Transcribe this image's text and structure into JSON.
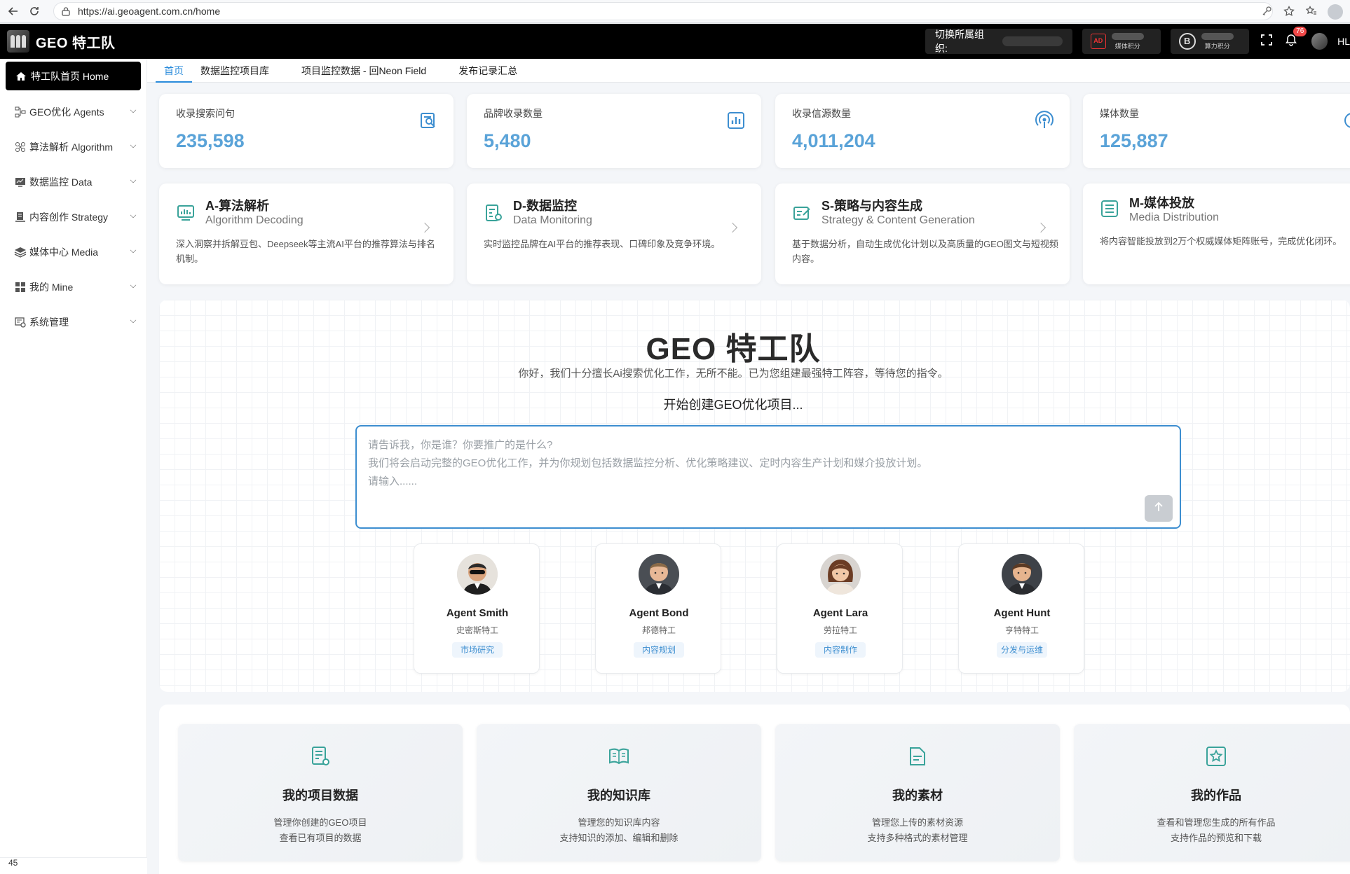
{
  "browser": {
    "url": "https://ai.geoagent.com.cn/home"
  },
  "header": {
    "title": "GEO 特工队",
    "org_switch_label": "切换所属组织:",
    "media_points_label": "媒体积分",
    "compute_points_label": "算力积分",
    "notification_count": "76",
    "user_name": "HL"
  },
  "sidebar": {
    "home_label": "特工队首页 Home",
    "items": [
      {
        "label": "GEO优化 Agents",
        "icon": "agents-icon"
      },
      {
        "label": "算法解析 Algorithm",
        "icon": "algorithm-icon"
      },
      {
        "label": "数据监控 Data",
        "icon": "monitor-icon"
      },
      {
        "label": "内容创作 Strategy",
        "icon": "content-icon"
      },
      {
        "label": "媒体中心 Media",
        "icon": "layers-icon"
      },
      {
        "label": "我的 Mine",
        "icon": "grid-icon"
      },
      {
        "label": "系统管理",
        "icon": "settings-icon"
      }
    ],
    "bottom_text": "45"
  },
  "tabs": [
    {
      "label": "首页",
      "active": true
    },
    {
      "label": "数据监控项目库",
      "active": false
    },
    {
      "label": "项目监控数据 - 回Neon Field",
      "active": false
    },
    {
      "label": "发布记录汇总",
      "active": false
    }
  ],
  "stats": [
    {
      "label": "收录搜索问句",
      "value": "235,598",
      "icon": "search-doc-icon"
    },
    {
      "label": "品牌收录数量",
      "value": "5,480",
      "icon": "bar-chart-icon"
    },
    {
      "label": "收录信源数量",
      "value": "4,011,204",
      "icon": "signal-icon"
    },
    {
      "label": "媒体数量",
      "value": "125,887",
      "icon": "media-icon"
    }
  ],
  "modules": [
    {
      "title": "A-算法解析",
      "subtitle": "Algorithm Decoding",
      "desc": "深入洞察并拆解豆包、Deepseek等主流AI平台的推荐算法与排名机制。",
      "icon": "algorithm-chart-icon"
    },
    {
      "title": "D-数据监控",
      "subtitle": "Data Monitoring",
      "desc": "实时监控品牌在AI平台的推荐表现、口碑印象及竞争环境。",
      "icon": "data-monitor-icon"
    },
    {
      "title": "S-策略与内容生成",
      "subtitle": "Strategy & Content Generation",
      "desc": "基于数据分析，自动生成优化计划以及高质量的GEO图文与短视频内容。",
      "icon": "strategy-edit-icon"
    },
    {
      "title": "M-媒体投放",
      "subtitle": "Media Distribution",
      "desc": "将内容智能投放到2万个权威媒体矩阵账号，完成优化闭环。",
      "icon": "list-icon"
    }
  ],
  "hero": {
    "title": "GEO 特工队",
    "subtitle": "你好，我们十分擅长Ai搜索优化工作，无所不能。已为您组建最强特工阵容，等待您的指令。",
    "start_text": "开始创建GEO优化项目...",
    "placeholder": "请告诉我，你是谁？你要推广的是什么?\n我们将会启动完整的GEO优化工作，并为你规划包括数据监控分析、优化策略建议、定时内容生产计划和媒介投放计划。\n请输入......"
  },
  "agents": [
    {
      "name": "Agent Smith",
      "cn": "史密斯特工",
      "tag": "市场研究",
      "avatar": "agent-smith-avatar"
    },
    {
      "name": "Agent Bond",
      "cn": "邦德特工",
      "tag": "内容规划",
      "avatar": "agent-bond-avatar"
    },
    {
      "name": "Agent Lara",
      "cn": "劳拉特工",
      "tag": "内容制作",
      "avatar": "agent-lara-avatar"
    },
    {
      "name": "Agent Hunt",
      "cn": "亨特特工",
      "tag": "分发与运维",
      "avatar": "agent-hunt-avatar"
    }
  ],
  "bottom_cards": [
    {
      "title": "我的项目数据",
      "desc1": "管理你创建的GEO项目",
      "desc2": "查看已有项目的数据",
      "icon": "project-doc-icon"
    },
    {
      "title": "我的知识库",
      "desc1": "管理您的知识库内容",
      "desc2": "支持知识的添加、编辑和删除",
      "icon": "book-icon"
    },
    {
      "title": "我的素材",
      "desc1": "管理您上传的素材资源",
      "desc2": "支持多种格式的素材管理",
      "icon": "folder-icon"
    },
    {
      "title": "我的作品",
      "desc1": "查看和管理您生成的所有作品",
      "desc2": "支持作品的预览和下载",
      "icon": "star-icon"
    }
  ],
  "colors": {
    "accent": "#2a8bdb",
    "stat_value": "#5aa3d8",
    "icon_teal": "#3aa39a",
    "header_bg": "#000000"
  }
}
